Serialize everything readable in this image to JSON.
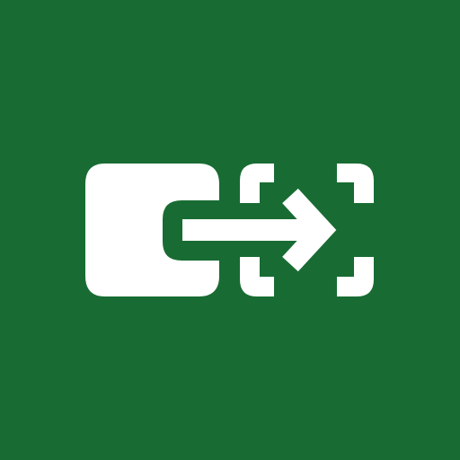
{
  "icon": {
    "name": "move-to-placeholder-icon",
    "background_color": "#186C33",
    "foreground_color": "#FFFFFF"
  }
}
